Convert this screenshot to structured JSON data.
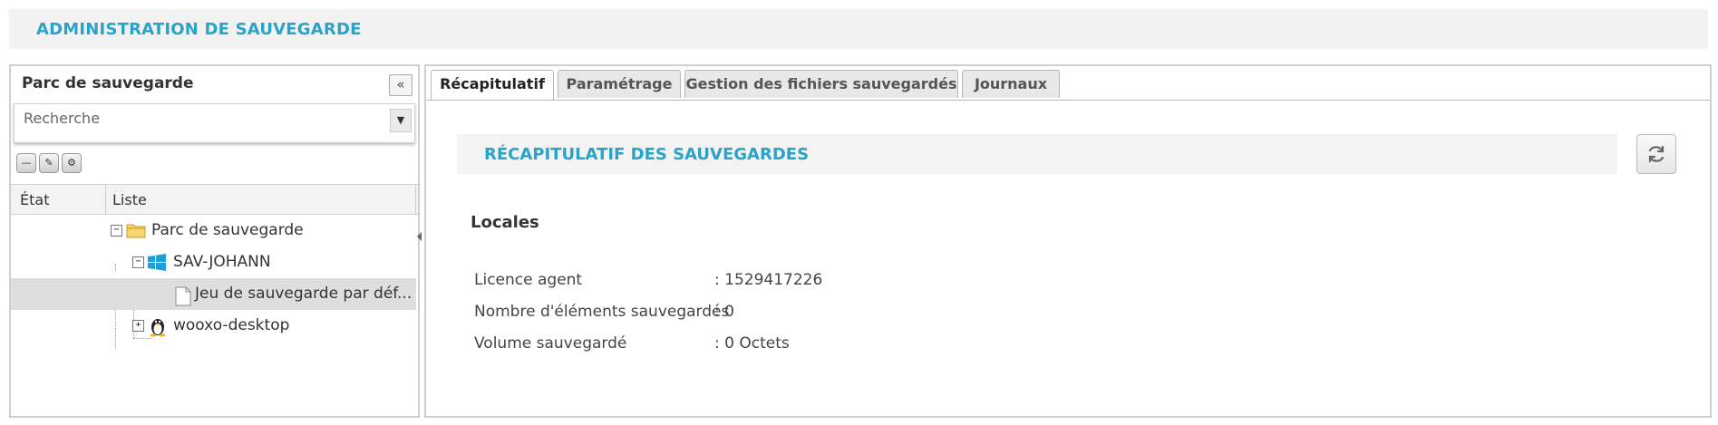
{
  "header": {
    "title": "ADMINISTRATION DE SAUVEGARDE"
  },
  "sidebar": {
    "title": "Parc de sauvegarde",
    "collapse_glyph": "«",
    "search": {
      "placeholder": "Recherche"
    },
    "toolbar": {
      "icons": [
        "minus-icon",
        "edit-icon",
        "settings-icon"
      ]
    },
    "columns": [
      "État",
      "Liste"
    ],
    "tree": [
      {
        "label": "Parc de sauvegarde",
        "icon": "folder-icon",
        "expander": "−"
      },
      {
        "label": "SAV-JOHANN",
        "icon": "windows-icon",
        "expander": "−"
      },
      {
        "label": "Jeu de sauvegarde par déf...",
        "icon": "document-icon",
        "selected": true
      },
      {
        "label": "wooxo-desktop",
        "icon": "linux-icon",
        "expander": "+"
      }
    ]
  },
  "tabs": [
    {
      "label": "Récapitulatif",
      "active": true
    },
    {
      "label": "Paramétrage"
    },
    {
      "label": "Gestion des fichiers sauvegardés"
    },
    {
      "label": "Journaux"
    }
  ],
  "main": {
    "section_title": "RÉCAPITULATIF DES SAUVEGARDES",
    "subsection": "Locales",
    "rows": [
      {
        "key": "Licence agent",
        "value": ": 1529417226"
      },
      {
        "key": "Nombre d'éléments sauvegardés",
        "value": ": 0"
      },
      {
        "key": "Volume sauvegardé",
        "value": ": 0 Octets"
      }
    ]
  },
  "colors": {
    "accent": "#2aa3c9",
    "panel_border": "#cfcfcf",
    "selected_row": "#dedede"
  }
}
